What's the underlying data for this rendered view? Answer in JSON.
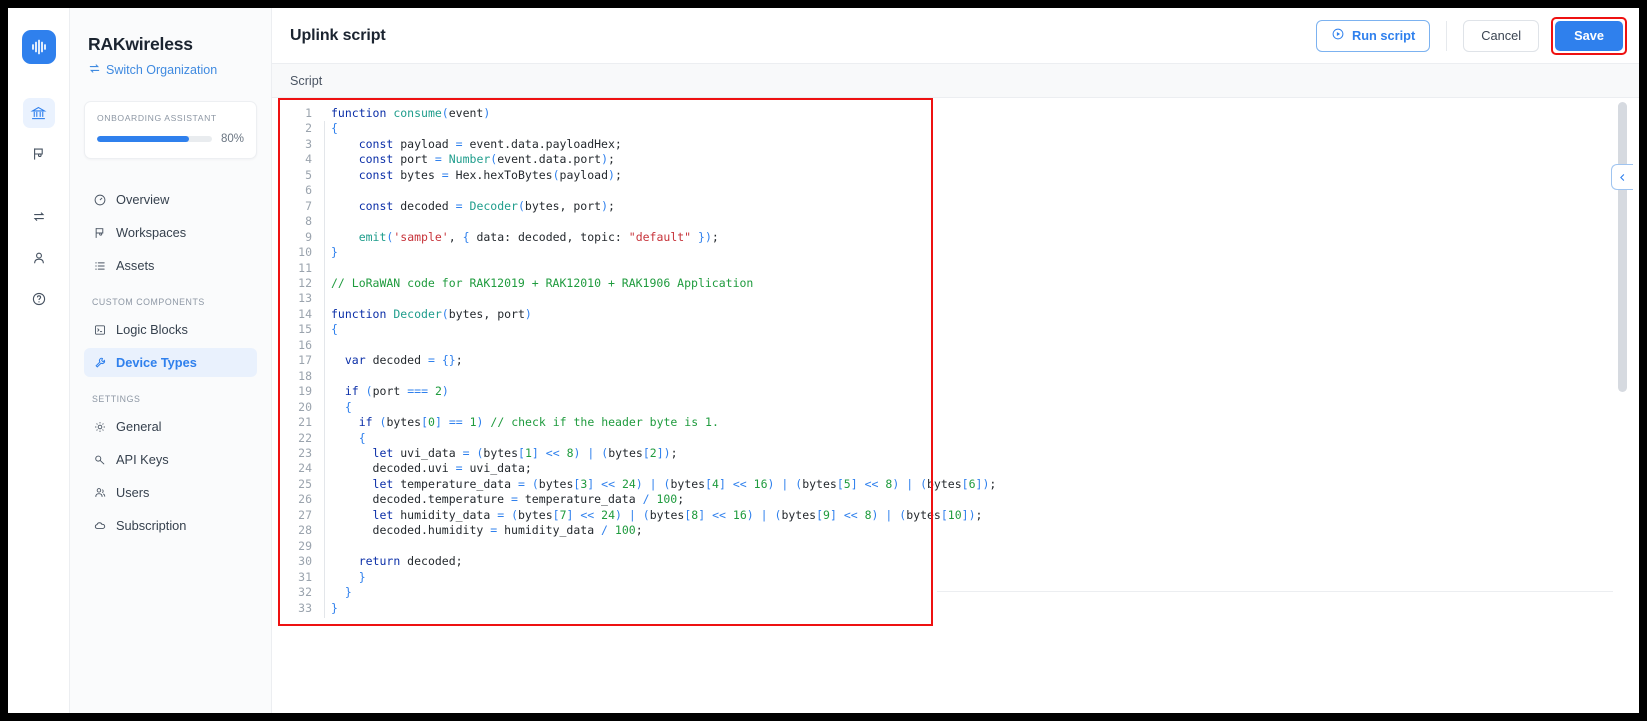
{
  "rail": {
    "logo_icon": "audio-waveform-logo",
    "items": [
      {
        "icon": "bank-icon",
        "name": "rail-item-organization",
        "active": true
      },
      {
        "icon": "flag-icon",
        "name": "rail-item-workspaces",
        "active": false
      },
      {
        "icon": "transfer-icon",
        "name": "rail-item-transfer",
        "active": false
      },
      {
        "icon": "user-icon",
        "name": "rail-item-account",
        "active": false
      },
      {
        "icon": "help-icon",
        "name": "rail-item-help",
        "active": false
      }
    ]
  },
  "sidebar": {
    "org_name": "RAKwireless",
    "switch_org_label": "Switch Organization",
    "switch_org_icon": "switch-arrows-icon",
    "onboarding": {
      "label": "ONBOARDING ASSISTANT",
      "percent_label": "80%",
      "percent_value": 80,
      "bar_color": "#2f80ed"
    },
    "nav": [
      {
        "label": "Overview",
        "icon": "gauge-icon",
        "active": false
      },
      {
        "label": "Workspaces",
        "icon": "flag-icon",
        "active": false
      },
      {
        "label": "Assets",
        "icon": "list-icon",
        "active": false
      }
    ],
    "section_custom_components": "CUSTOM COMPONENTS",
    "custom_components": [
      {
        "label": "Logic Blocks",
        "icon": "terminal-icon",
        "active": false
      },
      {
        "label": "Device Types",
        "icon": "wrench-icon",
        "active": true
      }
    ],
    "section_settings": "SETTINGS",
    "settings": [
      {
        "label": "General",
        "icon": "gear-icon",
        "active": false
      },
      {
        "label": "API Keys",
        "icon": "key-icon",
        "active": false
      },
      {
        "label": "Users",
        "icon": "users-icon",
        "active": false
      },
      {
        "label": "Subscription",
        "icon": "cloud-icon",
        "active": false
      }
    ]
  },
  "header": {
    "title": "Uplink script",
    "run_script_label": "Run script",
    "run_script_icon": "play-circle-icon",
    "cancel_label": "Cancel",
    "save_label": "Save",
    "save_color": "#2f80ed",
    "highlight_color": "#ee1111"
  },
  "subbar": {
    "tab_label": "Script"
  },
  "editor": {
    "collapse_icon": "chevron-left-icon",
    "line_numbers": [
      1,
      2,
      3,
      4,
      5,
      6,
      7,
      8,
      9,
      10,
      11,
      12,
      13,
      14,
      15,
      16,
      17,
      18,
      19,
      20,
      21,
      22,
      23,
      24,
      25,
      26,
      27,
      28,
      29,
      30,
      31,
      32,
      33
    ],
    "language": "javascript",
    "code_lines": [
      "function consume(event)",
      "{",
      "    const payload = event.data.payloadHex;",
      "    const port = Number(event.data.port);",
      "    const bytes = Hex.hexToBytes(payload);",
      "",
      "    const decoded = Decoder(bytes, port);",
      "",
      "    emit('sample', { data: decoded, topic: \"default\" });",
      "}",
      "",
      "// LoRaWAN code for RAK12019 + RAK12010 + RAK1906 Application",
      "",
      "function Decoder(bytes, port)",
      "{",
      "",
      "  var decoded = {};",
      "",
      "  if (port === 2)",
      "  {",
      "    if (bytes[0] == 1) // check if the header byte is 1.",
      "    {",
      "      let uvi_data = (bytes[1] << 8) | (bytes[2]);",
      "      decoded.uvi = uvi_data;",
      "      let temperature_data = (bytes[3] << 24) | (bytes[4] << 16) | (bytes[5] << 8) | (bytes[6]);",
      "      decoded.temperature = temperature_data / 100;",
      "      let humidity_data = (bytes[7] << 24) | (bytes[8] << 16) | (bytes[9] << 8) | (bytes[10]);",
      "      decoded.humidity = humidity_data / 100;",
      "",
      "    return decoded;",
      "    }",
      "  }",
      "}"
    ]
  }
}
